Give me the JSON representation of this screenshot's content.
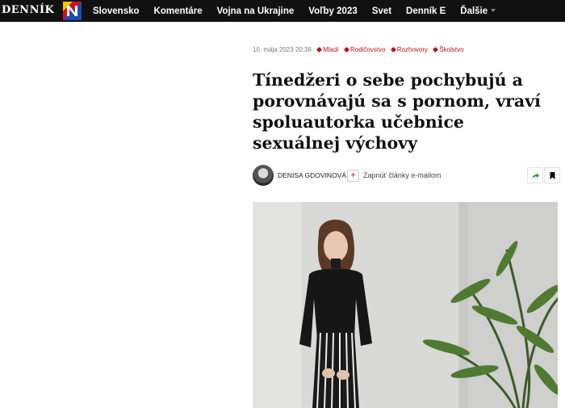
{
  "header": {
    "logo_text": "DENNÍK",
    "nav": [
      {
        "label": "Slovensko"
      },
      {
        "label": "Komentáre"
      },
      {
        "label": "Vojna na Ukrajine"
      },
      {
        "label": "Voľby 2023"
      },
      {
        "label": "Svet"
      },
      {
        "label": "Denník E"
      },
      {
        "label": "Ďalšie"
      }
    ]
  },
  "article": {
    "date": "10. mája 2023 20:36",
    "tags": [
      "Mladí",
      "Rodičovstvo",
      "Rozhovory",
      "Školstvo"
    ],
    "title": "Tínedžeri o sebe pochybujú a porovnávajú sa s pornom, vraví spoluautorka učebnice sexuálnej výchovy",
    "author": "Denisa Gdovinová",
    "subscribe_label": "Zapnúť články e-mailom"
  },
  "colors": {
    "brand_red": "#b1151f",
    "nav_bg": "#111111",
    "tag_red": "#b1151f",
    "share_green": "#2a9d3a"
  },
  "icons": {
    "logo_mark": "dennik-n-logo-icon",
    "share": "share-arrow-icon",
    "bookmark": "bookmark-icon",
    "plus": "plus-icon",
    "tag": "tag-icon"
  }
}
